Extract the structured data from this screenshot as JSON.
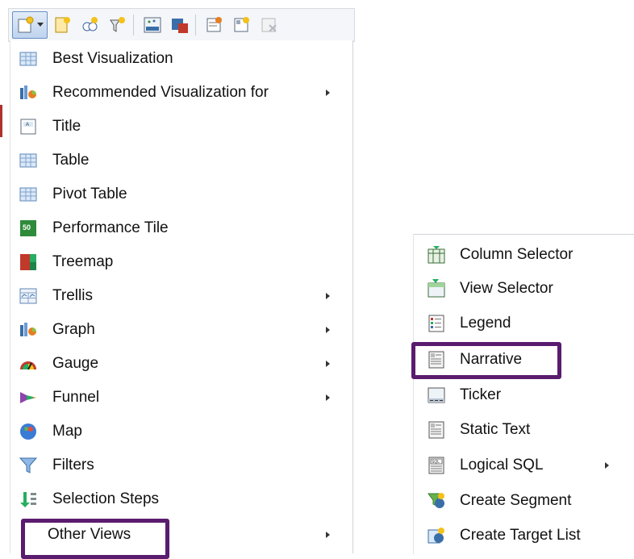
{
  "toolbar": {
    "buttons": [
      {
        "icon": "new-view-icon"
      },
      {
        "icon": "edit-icon"
      },
      {
        "icon": "group-icon"
      },
      {
        "icon": "filter-config-icon"
      },
      {
        "icon": "xyz-chart-icon"
      },
      {
        "icon": "export-icon"
      },
      {
        "icon": "properties-icon"
      },
      {
        "icon": "layout-icon"
      },
      {
        "icon": "remove-icon"
      }
    ]
  },
  "main_menu": {
    "items": [
      {
        "label": "Best Visualization",
        "icon": "table-icon",
        "submenu": false
      },
      {
        "label": "Recommended Visualization for",
        "icon": "graph-icon",
        "submenu": true
      },
      {
        "label": "Title",
        "icon": "title-icon",
        "submenu": false
      },
      {
        "label": "Table",
        "icon": "table-icon",
        "submenu": false
      },
      {
        "label": "Pivot Table",
        "icon": "pivot-table-icon",
        "submenu": false
      },
      {
        "label": "Performance Tile",
        "icon": "performance-tile-icon",
        "tile_text": "50",
        "submenu": false
      },
      {
        "label": "Treemap",
        "icon": "treemap-icon",
        "submenu": false
      },
      {
        "label": "Trellis",
        "icon": "trellis-icon",
        "submenu": true
      },
      {
        "label": "Graph",
        "icon": "graph-icon",
        "submenu": true
      },
      {
        "label": "Gauge",
        "icon": "gauge-icon",
        "submenu": true
      },
      {
        "label": "Funnel",
        "icon": "funnel-icon",
        "submenu": true
      },
      {
        "label": "Map",
        "icon": "map-icon",
        "submenu": false
      },
      {
        "label": "Filters",
        "icon": "filter-icon",
        "submenu": false
      },
      {
        "label": "Selection Steps",
        "icon": "selection-steps-icon",
        "submenu": false
      },
      {
        "label": "Other Views",
        "icon": "",
        "submenu": true,
        "highlighted": true
      }
    ]
  },
  "sub_menu": {
    "items": [
      {
        "label": "Column Selector",
        "icon": "column-selector-icon",
        "submenu": false
      },
      {
        "label": "View Selector",
        "icon": "view-selector-icon",
        "submenu": false
      },
      {
        "label": "Legend",
        "icon": "legend-icon",
        "submenu": false
      },
      {
        "label": "Narrative",
        "icon": "narrative-icon",
        "submenu": false,
        "highlighted": true
      },
      {
        "label": "Ticker",
        "icon": "ticker-icon",
        "submenu": false
      },
      {
        "label": "Static Text",
        "icon": "static-text-icon",
        "submenu": false
      },
      {
        "label": "Logical SQL",
        "icon": "logical-sql-icon",
        "icon_text": "SQL",
        "submenu": true
      },
      {
        "label": "Create Segment",
        "icon": "create-segment-icon",
        "submenu": false
      },
      {
        "label": "Create Target List",
        "icon": "create-target-list-icon",
        "submenu": false
      }
    ]
  },
  "colors": {
    "highlight_border": "#5a1c6e",
    "menu_border": "#cfd3d8"
  }
}
